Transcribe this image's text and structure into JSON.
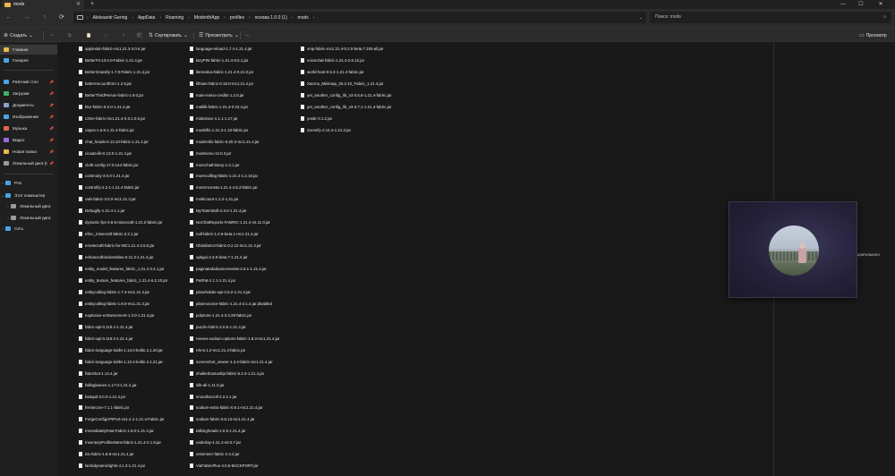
{
  "window": {
    "tab_title": "mods",
    "new_tab": "+",
    "minimize": "—",
    "maximize": "☐",
    "close": "✕",
    "tab_close": "✕"
  },
  "nav": {
    "back": "←",
    "forward": "→",
    "up": "↑",
    "refresh": "⟳"
  },
  "breadcrumb": [
    "Aleksandr Gering",
    "AppData",
    "Roaming",
    "ModrinthApp",
    "profiles",
    "основа 1.0.0 (1)",
    "mods"
  ],
  "breadcrumb_sep": "›",
  "address_end": "⌄",
  "search": {
    "placeholder": "Поиск: mods",
    "icon": "⌕"
  },
  "toolbar": {
    "create": "Создать",
    "sort": "Сортировать",
    "view": "Просмотреть",
    "more": "···",
    "preview": "Просмотр"
  },
  "icons": {
    "cut": "✂",
    "copy": "⧉",
    "paste": "📋",
    "rename": "▭",
    "share": "⇪",
    "delete": "🗑",
    "create": "⊕",
    "sort": "⇅",
    "view": "☰",
    "preview": "▭",
    "chev_down": "⌄",
    "pin": "📌",
    "expand": "›",
    "dropdown": "⌄"
  },
  "sidebar": {
    "items": [
      {
        "label": "Главная",
        "color": "#e8b84a",
        "selected": true
      },
      {
        "label": "Галерея",
        "color": "#4aa3e8"
      },
      {
        "label": "Рабочий стол",
        "color": "#4aa3e8",
        "pinned": true
      },
      {
        "label": "Загрузки",
        "color": "#3fb26b",
        "pinned": true
      },
      {
        "label": "Документы",
        "color": "#8aa4c8",
        "pinned": true
      },
      {
        "label": "Изображения",
        "color": "#4aa3e8",
        "pinned": true
      },
      {
        "label": "Музыка",
        "color": "#e06a4a",
        "pinned": true
      },
      {
        "label": "Видео",
        "color": "#9a6ae0",
        "pinned": true
      },
      {
        "label": "Новая папка",
        "color": "#e8b84a",
        "pinned": true
      },
      {
        "label": "Локальный диск (I",
        "color": "#9a9a9a",
        "pinned": true
      },
      {
        "label": "Pon",
        "color": "#4aa3e8"
      },
      {
        "label": "Этот компьютер",
        "color": "#4aa3e8"
      },
      {
        "label": "Локальный диск",
        "color": "#9a9a9a"
      },
      {
        "label": "Локальный диск",
        "color": "#9a9a9a"
      },
      {
        "label": "Сеть",
        "color": "#4aa3e8"
      }
    ]
  },
  "files": {
    "col1": [
      "appleskin-fabric-mc1.21.3-3.0.6.jar",
      "BetterF3-13.0.0-Fabric-1.21.4.jar",
      "BetterGrassify-1.7.0-Fabric.1.21.4.jar",
      "betterrecountfrom-1.2.5.jar",
      "BetterThirdPerson-fabric-1.9.0.jar",
      "blur-fabric-5.2.0-1.21.4.jar",
      "c2me-fabric-mc1.21.4-0.3.1.0.0.jar",
      "capes-1.5.5-1.21.4-fabric.jar",
      "chat_heads-0.13.10-fabric-1.21.4.jar",
      "cicada-lib-0.13.0-1.21.4.jar",
      "cloth-config-17.0.144-fabric.jar",
      "continuity-3.0.0-1.21.4.jar",
      "controlify-2.2.1-1.21.4-fabric.jar",
      "cwb-fabric-3.0.0-mc1.21.3.jar",
      "Debugify-1.21.4-1.1.jar",
      "dynamic-fps-3.9.5-minecraft-1.21.2-fabric.jar",
      "efmc_minecraft-fabric-3.2.1.jar",
      "emotecraft-fabric-for-MC1.21.4-2.5.0.jar",
      "enhancedblockentities-0.11.3-1.21.4.jar",
      "entity_model_features_fabric_1.21.4-2.4.1.jar",
      "entity_texture_features_fabric_1.21.4-6.2.10.jar",
      "entityculling-fabric-1.7.4-mc1.21.4.jar",
      "entityculling-fabric-1.8.0-mc1.21.4.jar",
      "explosive-enhancement-1.3.0-1.21.4.jar",
      "fabric-api-0.119.2-1.21.4.jar",
      "fabric-api-0.119.3-1.21.4.jar",
      "fabric-language-kotlin-1.13.0-kotlin.2.1.20.jar",
      "fabric-language-kotlin-1.13.2-kotlin.2.1.21.jar",
      "fabrishot-1.14.4.jar",
      "fallingleaves-1.17.0-1.21.4.jar",
      "fastquit-3.0.0-1.21.4.jar",
      "ferritecore-7.1.1-fabric.jar",
      "ForgeConfigAPIPort-v21.4.1-1.21.4-Fabric.jar",
      "ImmediatelyFast-Fabric-1.6.0-1.21.4.jar",
      "InventoryProfilesNext-fabric-1.21.4-2.1.8.jar",
      "iris-fabric-1.8.8-mc1.21.4.jar",
      "lambdynamiclights-4.1.3-1.21.4.jar"
    ],
    "col2": [
      "language-reload-1.7.4-1.21.4.jar",
      "lazyPIN-fabric-1.21.4-0.5.1.jar",
      "litematica-fabric-1.21.4-0.21.0.jar",
      "lithium-fabric-0.15.0-mc1.21.4.jar",
      "main-menu-credits-1.2.0.jar",
      "malilib-fabric-1.21.4-0.23.4.jar",
      "midetrace-1.1.1-1.17.jar",
      "modelfix-1.21.3-1.10-fabric.jar",
      "modernfix-fabric-5.20.3-mc1.21.4.jar",
      "modmenu-13.0.3.jar",
      "morechathistory-1.3.1.jar",
      "morecullling-fabric-1.21.4-1.2.10.jar",
      "moremcmeta-1.21.4-4.5.2-fabric.jar",
      "multicount-1.2.2-1.21.jar",
      "MyTotemDoll-2.3.0-1.21.4.jar",
      "NoChatReports-FABRIC-1.21.4-v2.11.0.jar",
      "null-fabric-1.0.6-beta.1-mc1.21.4.jar",
      "ObsidianUI-fabric-0.2.11-mc1.21.4.jar",
      "optigui-2.3.0-beta.7-1.21.2.jar",
      "paginatedadvancements-2.6.1-1.21.4.jar",
      "PatPat-1.1.1-1.21.4.jar",
      "placeholder-api-2.5.2-1.21.3.jar",
      "plasmovoice-fabric-1.21.4-2.1.4.jar.disabled",
      "polytone-1.21.4-3.3.28-fabric.jar",
      "puzzle-fabric-2.0.5-1.21.4.jar",
      "reeses-sodium-options-fabric-1.8.3-mc1.21.4.jar",
      "rrls-5.1.2-mc1.21.4-fabric.jar",
      "screenshot_viewer-1.3.4-fabric-mc1.21.4.jar",
      "shulkerboxtooltip-fabric-5.2.4-1.21.4.jar",
      "silk-all-1.11.0.jar",
      "smoothscroll-2.2.2.1.jar",
      "sodium-extra-fabric-0.6.1-mc1.21.4.jar",
      "sodium-fabric-0.6.13-mc1.21.4.jar",
      "talkingheads-1.0.6-1.21.4.jar",
      "underlay-1.21.2-v0.0.7.jar",
      "veinminer-fabric-2.4.2.jar",
      "ViaFabricPlus-4.0.5-BACKPORT.jar"
    ],
    "col3": [
      "vmp-fabric-mc1.21.4-0.2.0-beta.7.193-all.jar",
      "voicechat-fabric-1.21.4-2.6.12.jar",
      "world-host-0.5.2-1.21.4-fabric.jar",
      "Xaeros_Minimap_25.2.10_Fabric_1.21.4.jar",
      "yet_another_config_lib_v3-3.6.6-1.21.4-fabric.jar",
      "yet_another_config_lib_v3-3.7.1-1.21.4-fabric.jar",
      "yosbr-0.1.2.jar",
      "Zoomify-2.14.2-1.21.3.jar"
    ]
  },
  "preview_pane": {
    "text": "арительного"
  },
  "colors": {
    "background": "#191919",
    "toolbar": "#2b2b2b",
    "sidebar": "#1f1f1f",
    "folder": "#e8b84a"
  }
}
